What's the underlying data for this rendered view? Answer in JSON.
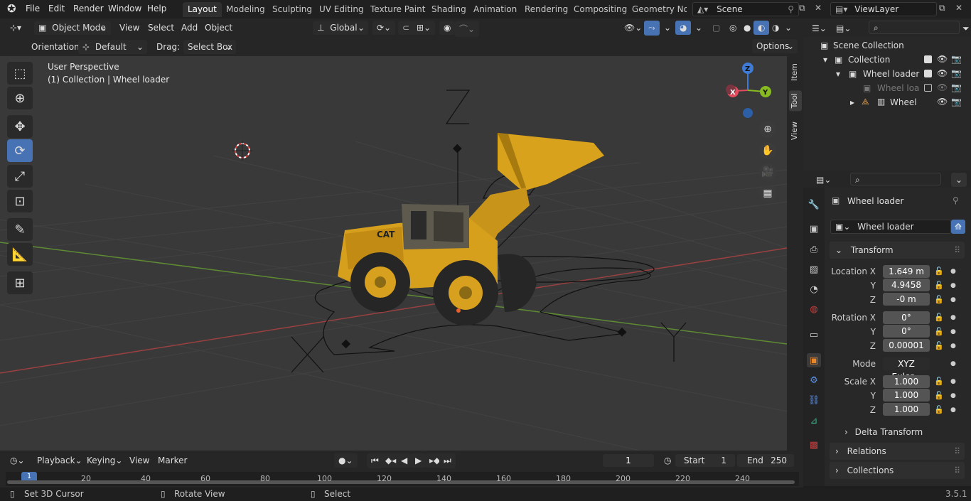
{
  "topbar": {
    "menus": [
      "File",
      "Edit",
      "Render",
      "Window",
      "Help"
    ],
    "workspaces": [
      "Layout",
      "Modeling",
      "Sculpting",
      "UV Editing",
      "Texture Paint",
      "Shading",
      "Animation",
      "Rendering",
      "Compositing",
      "Geometry Noc"
    ],
    "active_workspace": "Layout",
    "scene": "Scene",
    "view_layer": "ViewLayer"
  },
  "header": {
    "mode": "Object Mode",
    "menus": [
      "View",
      "Select",
      "Add",
      "Object"
    ],
    "transform_orientation": "Global",
    "orientation_label": "Orientation:",
    "orientation_value": "Default",
    "drag_label": "Drag:",
    "drag_value": "Select Box",
    "options": "Options"
  },
  "viewport": {
    "perspective": "User Perspective",
    "collection_info": "(1) Collection | Wheel loader",
    "gizmo": {
      "z": "Z",
      "x": "X",
      "y": "Y"
    },
    "side_tabs": [
      "Item",
      "Tool",
      "View"
    ],
    "colors": {
      "bg": "#393939",
      "x_axis": "#b04646",
      "y_axis": "#6a9a3a",
      "gizmo_x": "#e34b5e",
      "gizmo_y": "#88bb22",
      "gizmo_z": "#3d7bd6",
      "loader": "#e0a820"
    }
  },
  "outliner": {
    "root": "Scene Collection",
    "rows": [
      {
        "label": "Collection",
        "indent": 1,
        "arrow": "▾"
      },
      {
        "label": "Wheel loader",
        "indent": 2,
        "arrow": "▾"
      },
      {
        "label": "Wheel loade",
        "indent": 3,
        "arrow": ""
      },
      {
        "label": "Wheel l",
        "indent": 3,
        "arrow": "▸"
      }
    ]
  },
  "properties": {
    "object_name": "Wheel loader",
    "object_field": "Wheel loader",
    "transform_title": "Transform",
    "location": {
      "label": "Location X",
      "x": "1.649 m",
      "y": "4.9458",
      "z": "-0 m"
    },
    "rotation": {
      "label": "Rotation X",
      "x": "0°",
      "y": "0°",
      "z": "0.00001"
    },
    "mode_label": "Mode",
    "mode_value": "XYZ Euler",
    "scale": {
      "label": "Scale X",
      "x": "1.000",
      "y": "1.000",
      "z": "1.000"
    },
    "axis_y": "Y",
    "axis_z": "Z",
    "sections": [
      "Delta Transform",
      "Relations",
      "Collections"
    ]
  },
  "timeline": {
    "menus": [
      "Playback",
      "Keying",
      "View",
      "Marker"
    ],
    "current_frame": "1",
    "start_label": "Start",
    "start": "1",
    "end_label": "End",
    "end": "250",
    "ticks": [
      "1",
      "20",
      "40",
      "60",
      "80",
      "100",
      "120",
      "140",
      "160",
      "180",
      "200",
      "220",
      "240"
    ]
  },
  "statusbar": {
    "left": "Set 3D Cursor",
    "middle": "Rotate View",
    "right": "Select",
    "version": "3.5.1"
  }
}
